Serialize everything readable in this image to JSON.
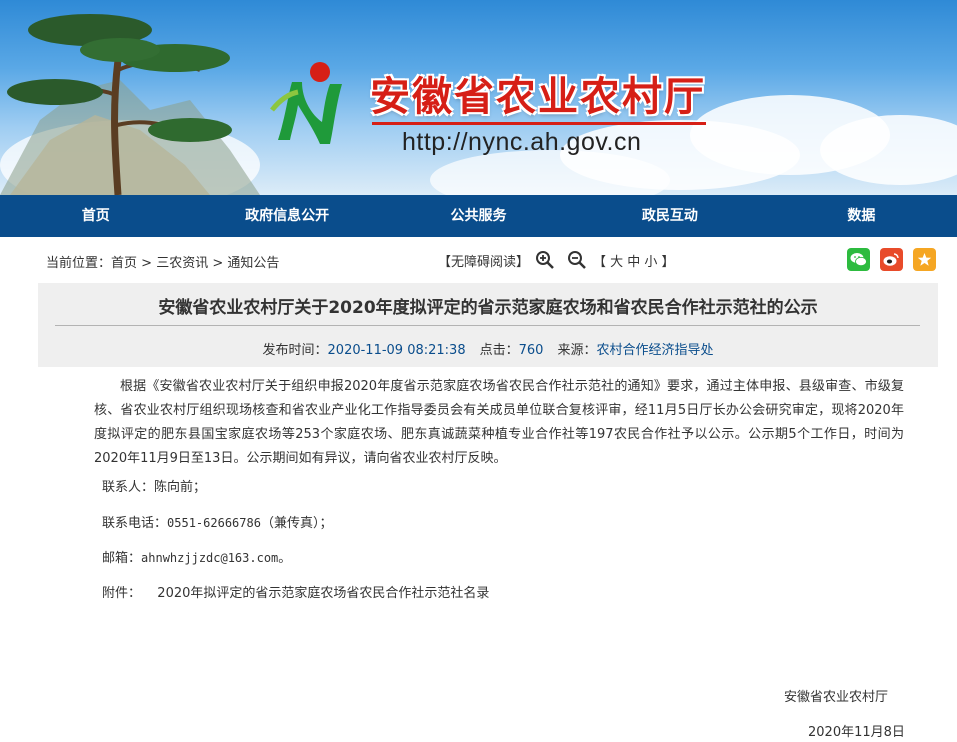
{
  "header": {
    "site_title": "安徽省农业农村厅",
    "site_url": "http://nync.ah.gov.cn"
  },
  "nav": {
    "items": [
      "首页",
      "政府信息公开",
      "公共服务",
      "政民互动",
      "数据"
    ]
  },
  "location": {
    "prefix": "当前位置：",
    "crumbs": [
      "首页",
      "三农资讯",
      "通知公告"
    ],
    "separator": " > "
  },
  "tools": {
    "accessible_read": "【无障碍阅读】",
    "font_size": "【 大 中 小 】"
  },
  "share": {
    "icons": [
      "wechat-icon",
      "weibo-icon",
      "favorite-star-icon"
    ],
    "colors": [
      "#2dbb3f",
      "#e84b2a",
      "#f5a623"
    ]
  },
  "article": {
    "title": "安徽省农业农村厅关于2020年度拟评定的省示范家庭农场和省农民合作社示范社的公示",
    "publish_label": "发布时间：",
    "publish_time": "2020-11-09 08:21:38",
    "clicks_label": "点击：",
    "clicks": "760",
    "source_label": "来源：",
    "source": "农村合作经济指导处",
    "paragraph": "根据《安徽省农业农村厅关于组织申报2020年度省示范家庭农场省农民合作社示范社的通知》要求，通过主体申报、县级审查、市级复核、省农业农村厅组织现场核查和省农业产业化工作指导委员会有关成员单位联合复核评审，经11月5日厅长办公会研究审定，现将2020年度拟评定的肥东县国宝家庭农场等253个家庭农场、肥东真诚蔬菜种植专业合作社等197农民合作社予以公示。公示期5个工作日，时间为2020年11月9日至13日。公示期间如有异议，请向省农业农村厅反映。",
    "contact_label": "联系人：",
    "contact": "陈向前；",
    "phone_label": "联系电话：",
    "phone": "0551-62666786",
    "phone_suffix": "（兼传真）；",
    "email_label": "邮箱：",
    "email": "ahnwhzjjzdc@163.com",
    "email_suffix": "。",
    "attachment_label": "附件：",
    "attachment": "2020年拟评定的省示范家庭农场省农民合作社示范社名录",
    "signature": "安徽省农业农村厅",
    "date": "2020年11月8日"
  },
  "colors": {
    "nav_bg": "#0a4d8c",
    "title_red": "#d61f16",
    "link_blue": "#0a4d8c",
    "head_bg": "#efefef"
  }
}
